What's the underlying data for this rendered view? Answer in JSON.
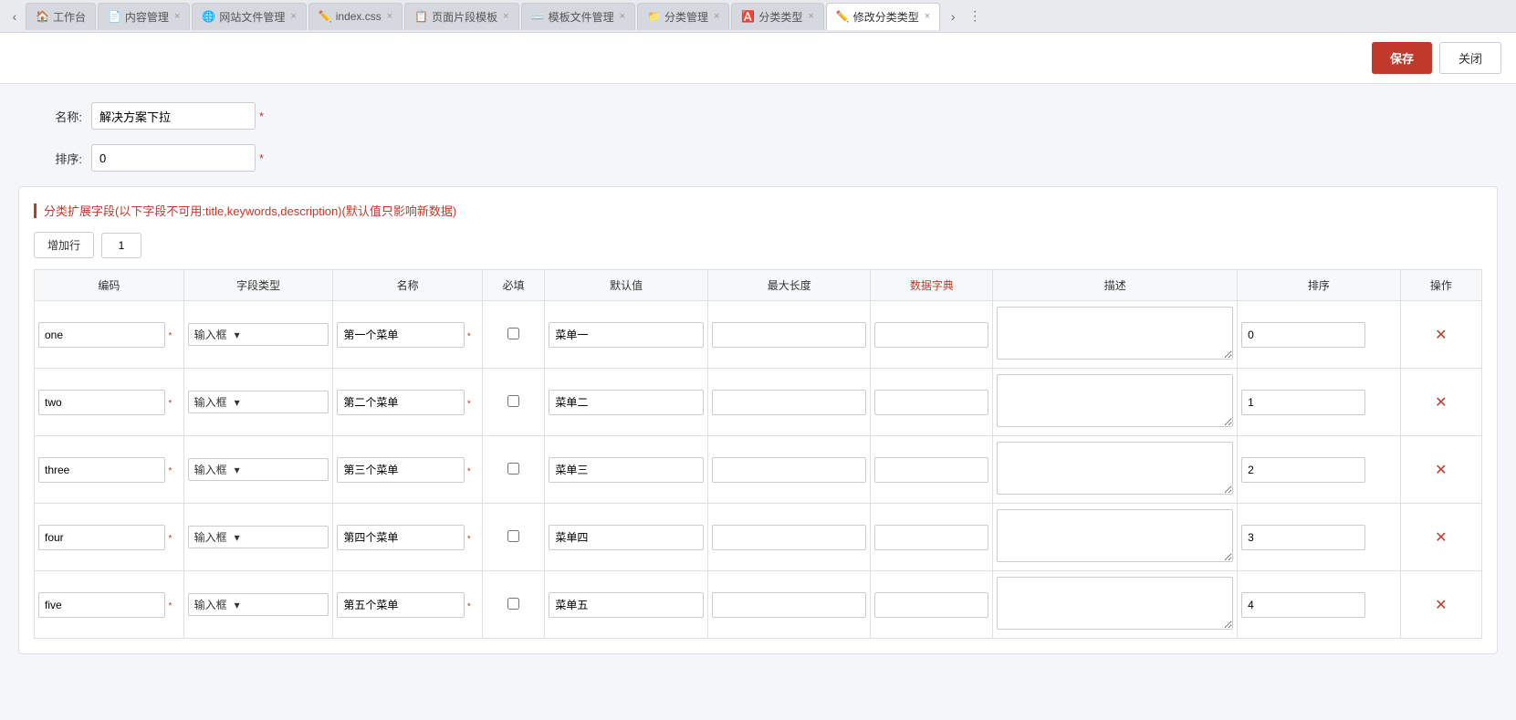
{
  "tabs": [
    {
      "id": "workbench",
      "label": "工作台",
      "icon": "🏠",
      "closable": false,
      "active": false
    },
    {
      "id": "content",
      "label": "内容管理",
      "icon": "📄",
      "closable": true,
      "active": false
    },
    {
      "id": "file-mgr",
      "label": "网站文件管理",
      "icon": "🌐",
      "closable": true,
      "active": false
    },
    {
      "id": "index-css",
      "label": "index.css",
      "icon": "✏️",
      "closable": true,
      "active": false
    },
    {
      "id": "page-seg",
      "label": "页面片段模板",
      "icon": "📋",
      "closable": true,
      "active": false
    },
    {
      "id": "tpl-file",
      "label": "模板文件管理",
      "icon": "⌨️",
      "closable": true,
      "active": false
    },
    {
      "id": "cat-mgr",
      "label": "分类管理",
      "icon": "📁",
      "closable": true,
      "active": false
    },
    {
      "id": "cat-type",
      "label": "分类类型",
      "icon": "🅰️",
      "closable": true,
      "active": false
    },
    {
      "id": "edit-cat",
      "label": "修改分类类型",
      "icon": "✏️",
      "closable": true,
      "active": true
    }
  ],
  "toolbar": {
    "save_label": "保存",
    "close_label": "关闭"
  },
  "form": {
    "name_label": "名称:",
    "name_value": "解决方案下拉",
    "sort_label": "排序:",
    "sort_value": "0"
  },
  "section": {
    "title": "分类扩展字段(以下字段不可用:title,keywords,description)(默认值只影响新数据)",
    "add_btn_label": "增加行",
    "row_count": "1"
  },
  "table": {
    "headers": [
      {
        "key": "code",
        "label": "编码",
        "red": false
      },
      {
        "key": "type",
        "label": "字段类型",
        "red": false
      },
      {
        "key": "name",
        "label": "名称",
        "red": false
      },
      {
        "key": "required",
        "label": "必填",
        "red": false
      },
      {
        "key": "default",
        "label": "默认值",
        "red": false
      },
      {
        "key": "maxlen",
        "label": "最大长度",
        "red": false
      },
      {
        "key": "dict",
        "label": "数据字典",
        "red": true
      },
      {
        "key": "desc",
        "label": "描述",
        "red": false
      },
      {
        "key": "sort",
        "label": "排序",
        "red": false
      },
      {
        "key": "op",
        "label": "操作",
        "red": false
      }
    ],
    "rows": [
      {
        "code": "one",
        "type": "输入框",
        "name": "第一个菜单",
        "required": false,
        "default": "菜单一",
        "maxlen": "",
        "dict": "",
        "desc": "",
        "sort": "0"
      },
      {
        "code": "two",
        "type": "输入框",
        "name": "第二个菜单",
        "required": false,
        "default": "菜单二",
        "maxlen": "",
        "dict": "",
        "desc": "",
        "sort": "1"
      },
      {
        "code": "three",
        "type": "输入框",
        "name": "第三个菜单",
        "required": false,
        "default": "菜单三",
        "maxlen": "",
        "dict": "",
        "desc": "",
        "sort": "2"
      },
      {
        "code": "four",
        "type": "输入框",
        "name": "第四个菜单",
        "required": false,
        "default": "菜单四",
        "maxlen": "",
        "dict": "",
        "desc": "",
        "sort": "3"
      },
      {
        "code": "five",
        "type": "输入框",
        "name": "第五个菜单",
        "required": false,
        "default": "菜单五",
        "maxlen": "",
        "dict": "",
        "desc": "",
        "sort": "4"
      }
    ]
  }
}
